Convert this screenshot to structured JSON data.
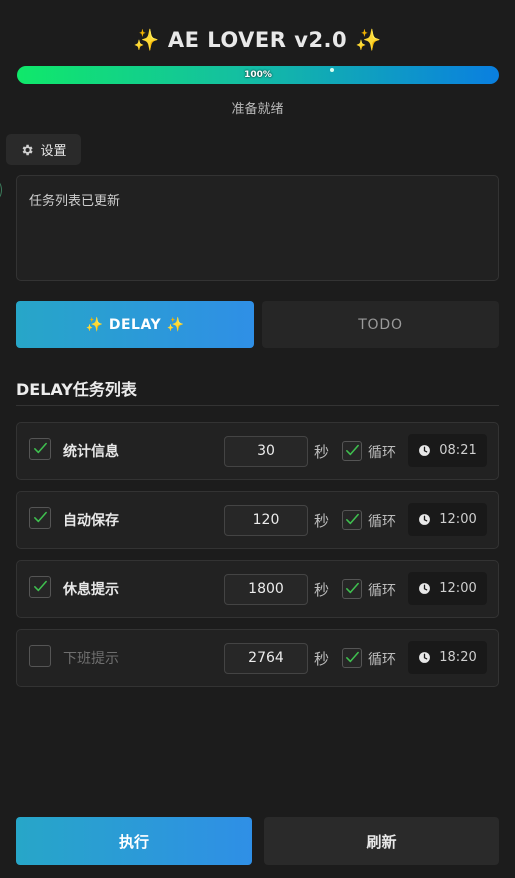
{
  "header": {
    "title": "✨ AE LOVER v2.0 ✨",
    "progress_percent": 100,
    "progress_label": "100%",
    "status": "准备就绪"
  },
  "settings_button": {
    "label": "设置",
    "icon": "gear-icon"
  },
  "log": {
    "text": "任务列表已更新"
  },
  "tabs": [
    {
      "label": "✨ DELAY ✨",
      "active": true
    },
    {
      "label": "TODO",
      "active": false
    }
  ],
  "section_title": "DELAY任务列表",
  "tasks": [
    {
      "name": "统计信息",
      "enabled": true,
      "seconds": "30",
      "unit": "秒",
      "loop": true,
      "loop_label": "循环",
      "time": "08:21"
    },
    {
      "name": "自动保存",
      "enabled": true,
      "seconds": "120",
      "unit": "秒",
      "loop": true,
      "loop_label": "循环",
      "time": "12:00"
    },
    {
      "name": "休息提示",
      "enabled": true,
      "seconds": "1800",
      "unit": "秒",
      "loop": true,
      "loop_label": "循环",
      "time": "12:00"
    },
    {
      "name": "下班提示",
      "enabled": false,
      "seconds": "2764",
      "unit": "秒",
      "loop": true,
      "loop_label": "循环",
      "time": "18:20"
    }
  ],
  "actions": {
    "execute_label": "执行",
    "refresh_label": "刷新"
  },
  "colors": {
    "background": "#1c1c1c",
    "accent_start": "#27a6c8",
    "accent_end": "#2f8fe6",
    "check": "#3fbf4f"
  }
}
